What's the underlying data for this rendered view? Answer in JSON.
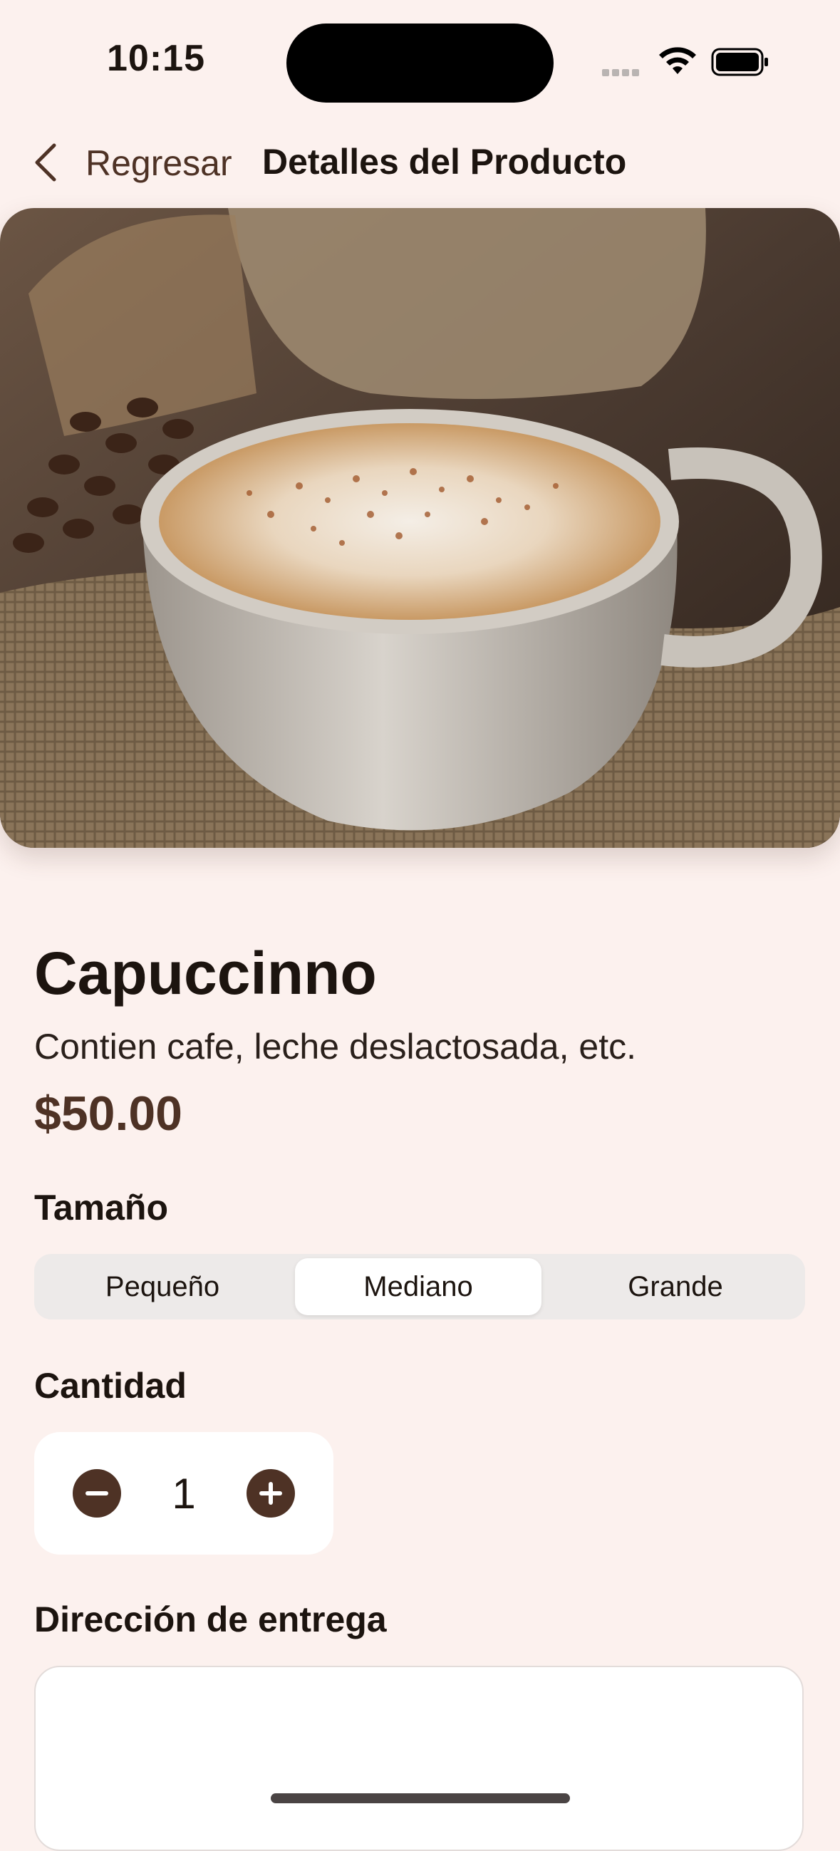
{
  "status_bar": {
    "time": "10:15"
  },
  "nav": {
    "back_label": "Regresar",
    "title": "Detalles del Producto"
  },
  "product": {
    "name": "Capuccinno",
    "description": "Contien cafe, leche deslactosada, etc.",
    "price": "$50.00"
  },
  "size": {
    "label": "Tamaño",
    "options": [
      "Pequeño",
      "Mediano",
      "Grande"
    ],
    "selected": "Mediano"
  },
  "quantity": {
    "label": "Cantidad",
    "value": "1"
  },
  "delivery": {
    "label": "Dirección de entrega",
    "value": ""
  },
  "colors": {
    "background": "#FCF1EE",
    "accent": "#4E3225",
    "segment_track": "#EDEAE9"
  }
}
